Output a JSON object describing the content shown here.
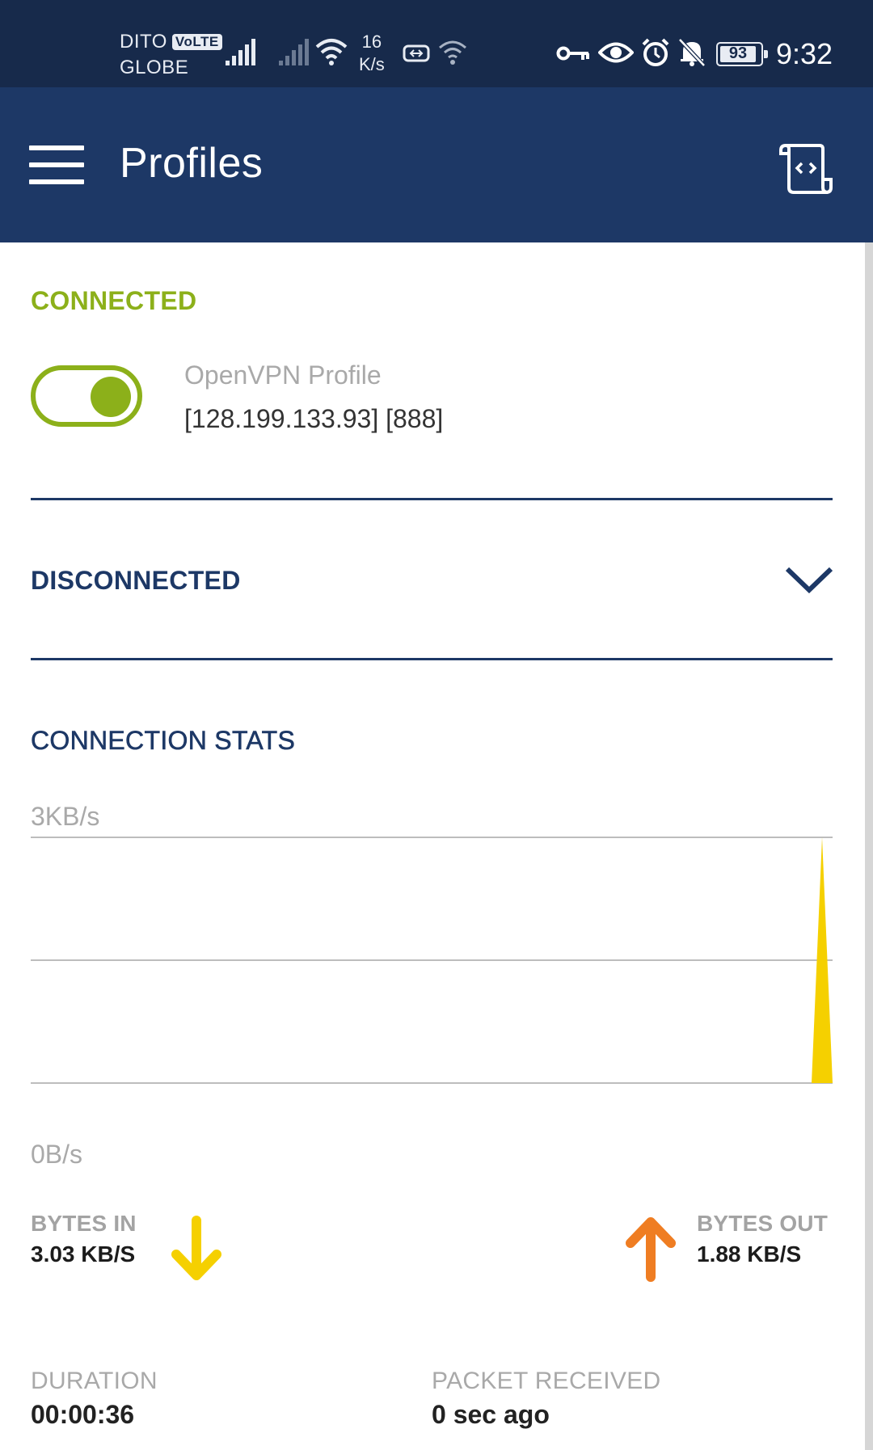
{
  "status_bar": {
    "carrier_1": "DITO",
    "carrier_1_badge": "VoLTE",
    "carrier_2": "GLOBE",
    "net_speed_value": "16",
    "net_speed_unit": "K/s",
    "battery": "93",
    "time": "9:32"
  },
  "app_bar": {
    "title": "Profiles",
    "menu_icon": "hamburger-menu-icon",
    "log_icon": "log-scroll-icon"
  },
  "connected": {
    "title": "CONNECTED",
    "toggle_on": true,
    "profile_name": "OpenVPN Profile",
    "profile_address": "[128.199.133.93] [888]"
  },
  "disconnected": {
    "title": "DISCONNECTED",
    "expand_icon": "chevron-down-icon"
  },
  "stats": {
    "title": "CONNECTION STATS",
    "bytes_in_label": "BYTES IN",
    "bytes_in_value": "3.03 KB/S",
    "bytes_out_label": "BYTES OUT",
    "bytes_out_value": "1.88 KB/S",
    "duration_label": "DURATION",
    "duration_value": "00:00:36",
    "packet_label": "PACKET RECEIVED",
    "packet_value": "0 sec ago"
  },
  "chart_data": {
    "type": "area",
    "title": "",
    "xlabel": "",
    "ylabel": "",
    "ylim": [
      0,
      3
    ],
    "y_unit": "KB/s",
    "tick_labels": [
      "3KB/s",
      "0B/s"
    ],
    "grid": true,
    "series": [
      {
        "color": "#f5d000",
        "x": [
          0,
          1,
          2
        ],
        "values": [
          0,
          3,
          0
        ]
      }
    ]
  },
  "colors": {
    "status_bar_bg": "#172a4b",
    "app_bar_bg": "#1d3866",
    "connected_green": "#8cb01a",
    "bytes_in_yellow": "#f5d000",
    "bytes_out_orange": "#ef7d22"
  }
}
